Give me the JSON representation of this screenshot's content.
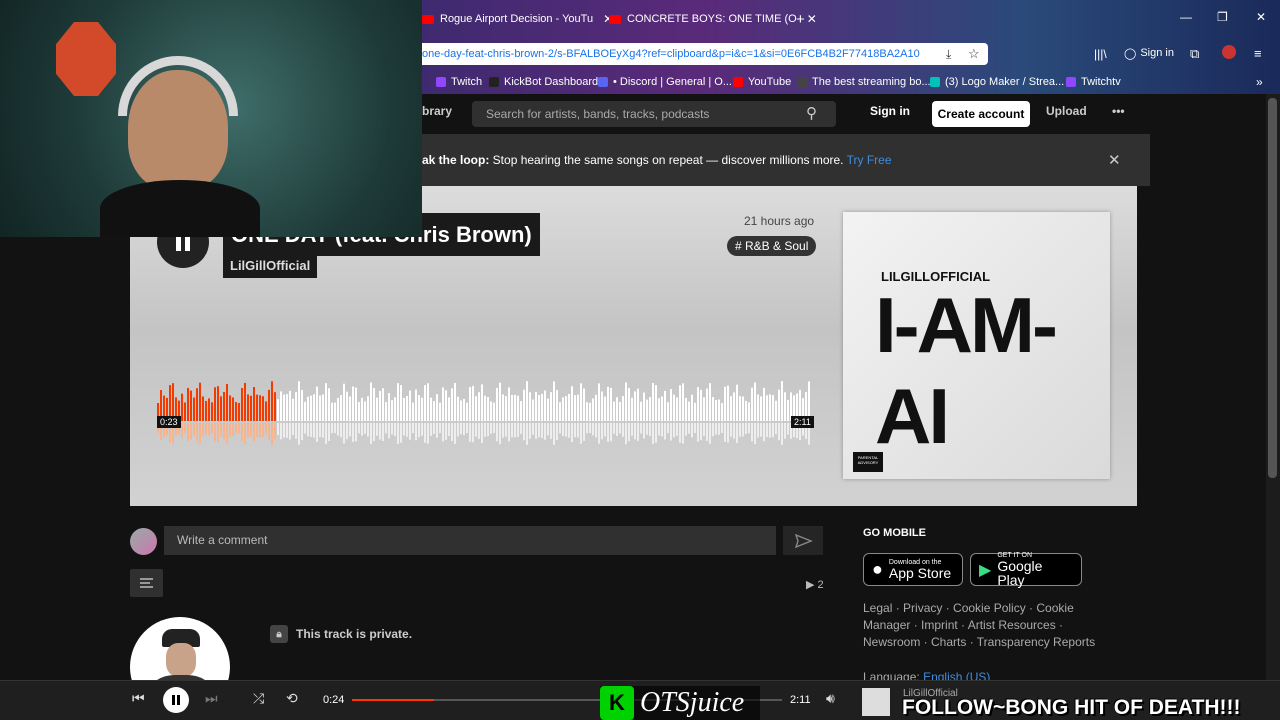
{
  "browser": {
    "tabs": [
      {
        "title": "Rogue Airport Decision - YouTu",
        "icon": "youtube-icon"
      },
      {
        "title": "CONCRETE BOYS: ONE TIME (O",
        "icon": "youtube-icon"
      }
    ],
    "new_tab": "+",
    "url": "one-day-feat-chris-brown-2/s-BFALBOEyXg4?ref=clipboard&p=i&c=1&si=0E6FCB4B2F77418BA2A10",
    "sign_in": "Sign in",
    "bookmarks": [
      {
        "label": "Twitch",
        "color": "#9146ff"
      },
      {
        "label": "KickBot Dashboard",
        "color": "#222222"
      },
      {
        "label": "• Discord | General | O...",
        "color": "#5865f2"
      },
      {
        "label": "YouTube",
        "color": "#ff0000"
      },
      {
        "label": "The best streaming bo...",
        "color": "#444444"
      },
      {
        "label": "(3) Logo Maker / Strea...",
        "color": "#00c2b8"
      },
      {
        "label": "Twitchtv",
        "color": "#9146ff"
      }
    ]
  },
  "header": {
    "library": "brary",
    "search_placeholder": "Search for artists, bands, tracks, podcasts",
    "sign_in": "Sign in",
    "create_account": "Create account",
    "upload": "Upload",
    "more": "•••"
  },
  "banner": {
    "bold": "ak the loop:",
    "text": " Stop hearing the same songs on repeat — discover millions more. ",
    "link": "Try Free",
    "close": "✕"
  },
  "track": {
    "title": "ONE DAY (feat. Chris Brown)",
    "artist": "LilGillOfficial",
    "posted": "21 hours ago",
    "tag": "# R&B & Soul",
    "current_time": "0:23",
    "duration": "2:11",
    "progress": 0.18,
    "artwork": {
      "artist_text": "LILGILLOFFICIAL",
      "album_text": "I-AM-AI",
      "advisory": "PARENTAL ADVISORY"
    }
  },
  "comments": {
    "placeholder": "Write a comment",
    "plays": "2",
    "private_text": "This track is private."
  },
  "sidebar": {
    "go_mobile": "GO MOBILE",
    "app_store_small": "Download on the",
    "app_store": "App Store",
    "google_small": "GET IT ON",
    "google": "Google Play",
    "links": "Legal · Privacy · Cookie Policy · Cookie Manager · Imprint · Artist Resources · Newsroom · Charts · Transparency Reports",
    "language_label": "Language: ",
    "language": "English (US)"
  },
  "player": {
    "time": "0:24",
    "duration": "2:11",
    "progress": 0.19,
    "artist": "LilGillOfficial"
  },
  "overlay": {
    "ots_logo": "K",
    "ots_text": "OTSjuice",
    "ticker": "FOLLOW~BONG HIT OF DEATH!!!"
  }
}
